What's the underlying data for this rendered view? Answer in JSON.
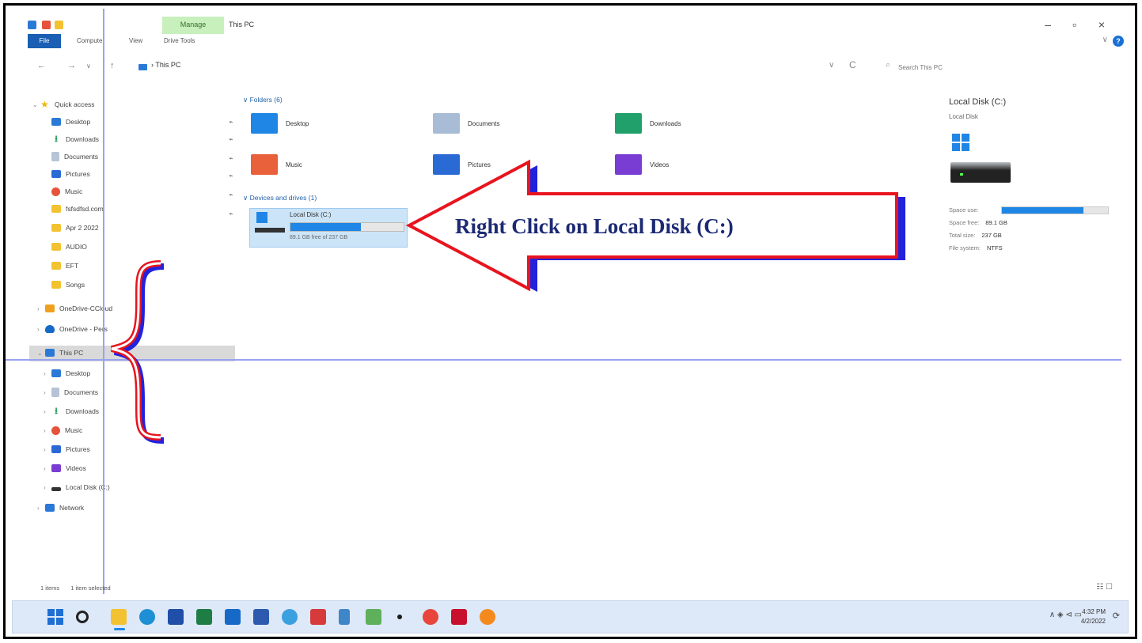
{
  "window": {
    "title": "This PC",
    "manage_tab": "Manage",
    "minimize": "–",
    "maximize": "▫",
    "close": "×"
  },
  "ribbon": {
    "file": "File",
    "tabs": [
      "Computer",
      "View",
      "Drive Tools"
    ],
    "help": "?",
    "collapse": "∨"
  },
  "address": {
    "back": "←",
    "forward": "→",
    "recent": "∨",
    "up": "↑",
    "path": "› This PC",
    "dropdown": "∨",
    "refresh": "C",
    "search_icon": "⌕",
    "search_placeholder": "Search This PC"
  },
  "nav": {
    "quick_access": "Quick access",
    "quick_items": [
      "Desktop",
      "Downloads",
      "Documents",
      "Pictures",
      "Music",
      "fsfsdfsd.com",
      "Apr 2 2022",
      "AUDIO",
      "EFT",
      "Songs"
    ],
    "onedrive_personal_cloud": "OneDrive-CCloud",
    "onedrive": "OneDrive - Pers",
    "this_pc": "This PC",
    "pc_items": [
      "Desktop",
      "Documents",
      "Downloads",
      "Music",
      "Pictures",
      "Videos",
      "Local Disk (C:)"
    ],
    "network": "Network",
    "pin": "⌁"
  },
  "content": {
    "folders_header": "∨ Folders (6)",
    "folders": [
      "Desktop",
      "Documents",
      "Downloads",
      "Music",
      "Pictures",
      "Videos"
    ],
    "devices_header": "∨ Devices and drives (1)",
    "drive": {
      "name": "Local Disk (C:)",
      "free_text": "89.1 GB free of 237 GB",
      "used_fraction": 0.62
    }
  },
  "details": {
    "title": "Local Disk (C:)",
    "subtitle": "Local Disk",
    "space_used_label": "Space use:",
    "space_used_fraction": 0.77,
    "space_free_label": "Space free:",
    "space_free": "89.1 GB",
    "total_size_label": "Total size:",
    "total_size": "237 GB",
    "file_system_label": "File system:",
    "file_system": "NTFS"
  },
  "annotation": {
    "callout": "Right Click on  Local Disk (C:)",
    "arrow_color": "#e8141e",
    "shadow_color": "#2222dd"
  },
  "status": {
    "items": "1 items",
    "selected": "1 item selected",
    "view_icons": "☷ ☐"
  },
  "taskbar": {
    "apps": [
      "windows-start",
      "search",
      "file-explorer",
      "edge",
      "store",
      "excel",
      "outlook",
      "word",
      "photos",
      "acrobat-reader-alt",
      "notepad",
      "images",
      "dot",
      "chrome",
      "acrobat",
      "firefox"
    ],
    "tray": "∧ ◈ ⊲ ▭",
    "time": "4:32 PM",
    "date": "4/2/2022",
    "notification": "⟳"
  }
}
